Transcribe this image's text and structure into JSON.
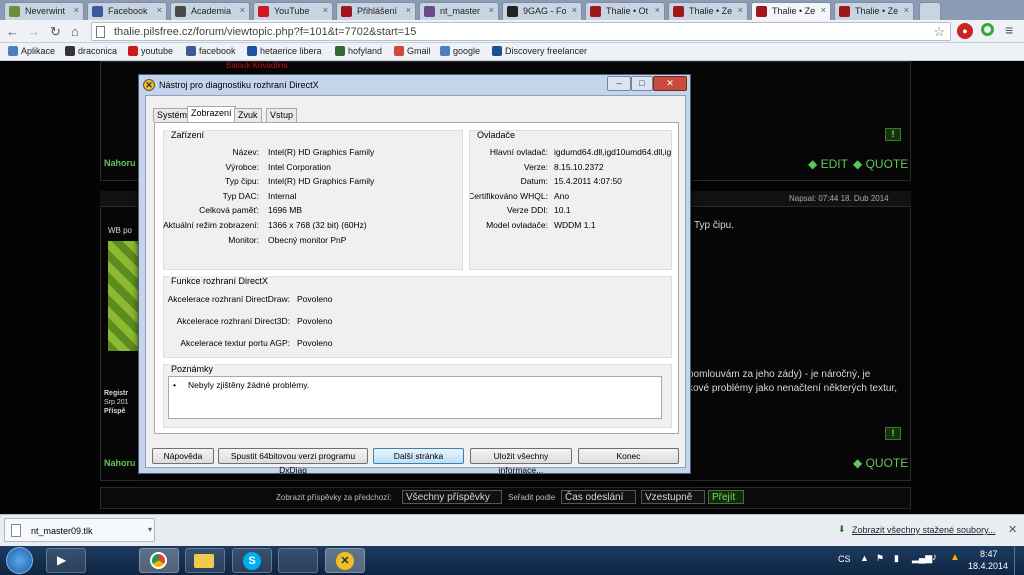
{
  "browser": {
    "tabs": [
      {
        "title": "Neverwint",
        "color": "#6b8f3a"
      },
      {
        "title": "Facebook",
        "color": "#3b5998"
      },
      {
        "title": "Academia",
        "color": "#4a4a4a"
      },
      {
        "title": "YouTube",
        "color": "#cc181e"
      },
      {
        "title": "Přihlášení",
        "color": "#a1161a"
      },
      {
        "title": "nt_master",
        "color": "#6a4a8a"
      },
      {
        "title": "9GAG - Fo",
        "color": "#222222"
      },
      {
        "title": "Thalie • Ot",
        "color": "#a1161a"
      },
      {
        "title": "Thalie • Ze",
        "color": "#a1161a"
      },
      {
        "title": "Thalie • Ze",
        "color": "#a1161a"
      },
      {
        "title": "Thalie • Ze",
        "color": "#a1161a"
      }
    ],
    "active_tab": 9,
    "url": "thalie.pilsfree.cz/forum/viewtopic.php?f=101&t=7702&start=15",
    "bookmarks": [
      {
        "label": "Aplikace",
        "color": "#4a7fc1"
      },
      {
        "label": "draconica",
        "color": "#333333"
      },
      {
        "label": "youtube",
        "color": "#cc181e"
      },
      {
        "label": "facebook",
        "color": "#3b5998"
      },
      {
        "label": "hetaerice libera",
        "color": "#1f4fa0"
      },
      {
        "label": "hofyland",
        "color": "#2f6a2f"
      },
      {
        "label": "Gmail",
        "color": "#d44638"
      },
      {
        "label": "google",
        "color": "#4a7fc1"
      },
      {
        "label": "Discovery freelancer",
        "color": "#1b4f8f"
      }
    ]
  },
  "forum": {
    "top_red_text": "Balouk Kovadlina",
    "nahoru": "Nahoru",
    "edit": "EDIT",
    "quote": "QUOTE",
    "napsal": "Napsal: 07:44 18. Dub 2014",
    "typ_cipu": "Typ čipu.",
    "user_fragment": "WB po",
    "reg_fragment": "Registr",
    "srp_fragment": "Srp 201",
    "prisp_fragment": "Příspě",
    "post_line1": "pomlouvám za jeho zády) - je náročný, je",
    "post_line2": "kové problémy jako nenačtení některých textur,",
    "bottom_bar": {
      "show_label": "Zobrazit příspěvky za předchozí:",
      "show_value": "Všechny příspěvky",
      "sort_label": "Seřadit podle",
      "sort_value": "Čas odeslání",
      "order_value": "Vzestupně",
      "go": "Přejít"
    }
  },
  "dialog": {
    "title": "Nástroj pro diagnostiku rozhraní DirectX",
    "tabs": [
      "Systém",
      "Zobrazení",
      "Zvuk",
      "Vstup"
    ],
    "active_tab": 1,
    "device": {
      "heading": "Zařízení",
      "rows": [
        {
          "label": "Název:",
          "value": "Intel(R) HD Graphics Family"
        },
        {
          "label": "Výrobce:",
          "value": "Intel Corporation"
        },
        {
          "label": "Typ čipu:",
          "value": "Intel(R) HD Graphics Family"
        },
        {
          "label": "Typ DAC:",
          "value": "Internal"
        },
        {
          "label": "Celková paměť:",
          "value": "1696 MB"
        },
        {
          "label": "Aktuální režim zobrazení:",
          "value": "1366 x 768 (32 bit) (60Hz)"
        },
        {
          "label": "Monitor:",
          "value": "Obecný monitor PnP"
        }
      ]
    },
    "drivers": {
      "heading": "Ovladače",
      "rows": [
        {
          "label": "Hlavní ovladač:",
          "value": "igdumd64.dll,igd10umd64.dll,igd"
        },
        {
          "label": "Verze:",
          "value": "8.15.10.2372"
        },
        {
          "label": "Datum:",
          "value": "15.4.2011 4:07:50"
        },
        {
          "label": "Certifikováno WHQL:",
          "value": "Ano"
        },
        {
          "label": "Verze DDI:",
          "value": "10.1"
        },
        {
          "label": "Model ovladače:",
          "value": "WDDM 1.1"
        }
      ]
    },
    "features": {
      "heading": "Funkce rozhraní DirectX",
      "rows": [
        {
          "label": "Akcelerace rozhraní DirectDraw:",
          "value": "Povoleno"
        },
        {
          "label": "Akcelerace rozhraní Direct3D:",
          "value": "Povoleno"
        },
        {
          "label": "Akcelerace textur portu AGP:",
          "value": "Povoleno"
        }
      ]
    },
    "notes": {
      "heading": "Poznámky",
      "text": "Nebyly zjištěny žádné problémy."
    },
    "buttons": {
      "help": "Nápověda",
      "run64": "Spustit 64bitovou verzi programu DxDiag",
      "next": "Další stránka",
      "save": "Uložit všechny informace...",
      "exit": "Konec"
    }
  },
  "downloads": {
    "file": "nt_master09.tlk",
    "show_all": "Zobrazit všechny stažené soubory..."
  },
  "taskbar": {
    "lang": "CS",
    "time": "8:47",
    "date": "18.4.2014"
  }
}
